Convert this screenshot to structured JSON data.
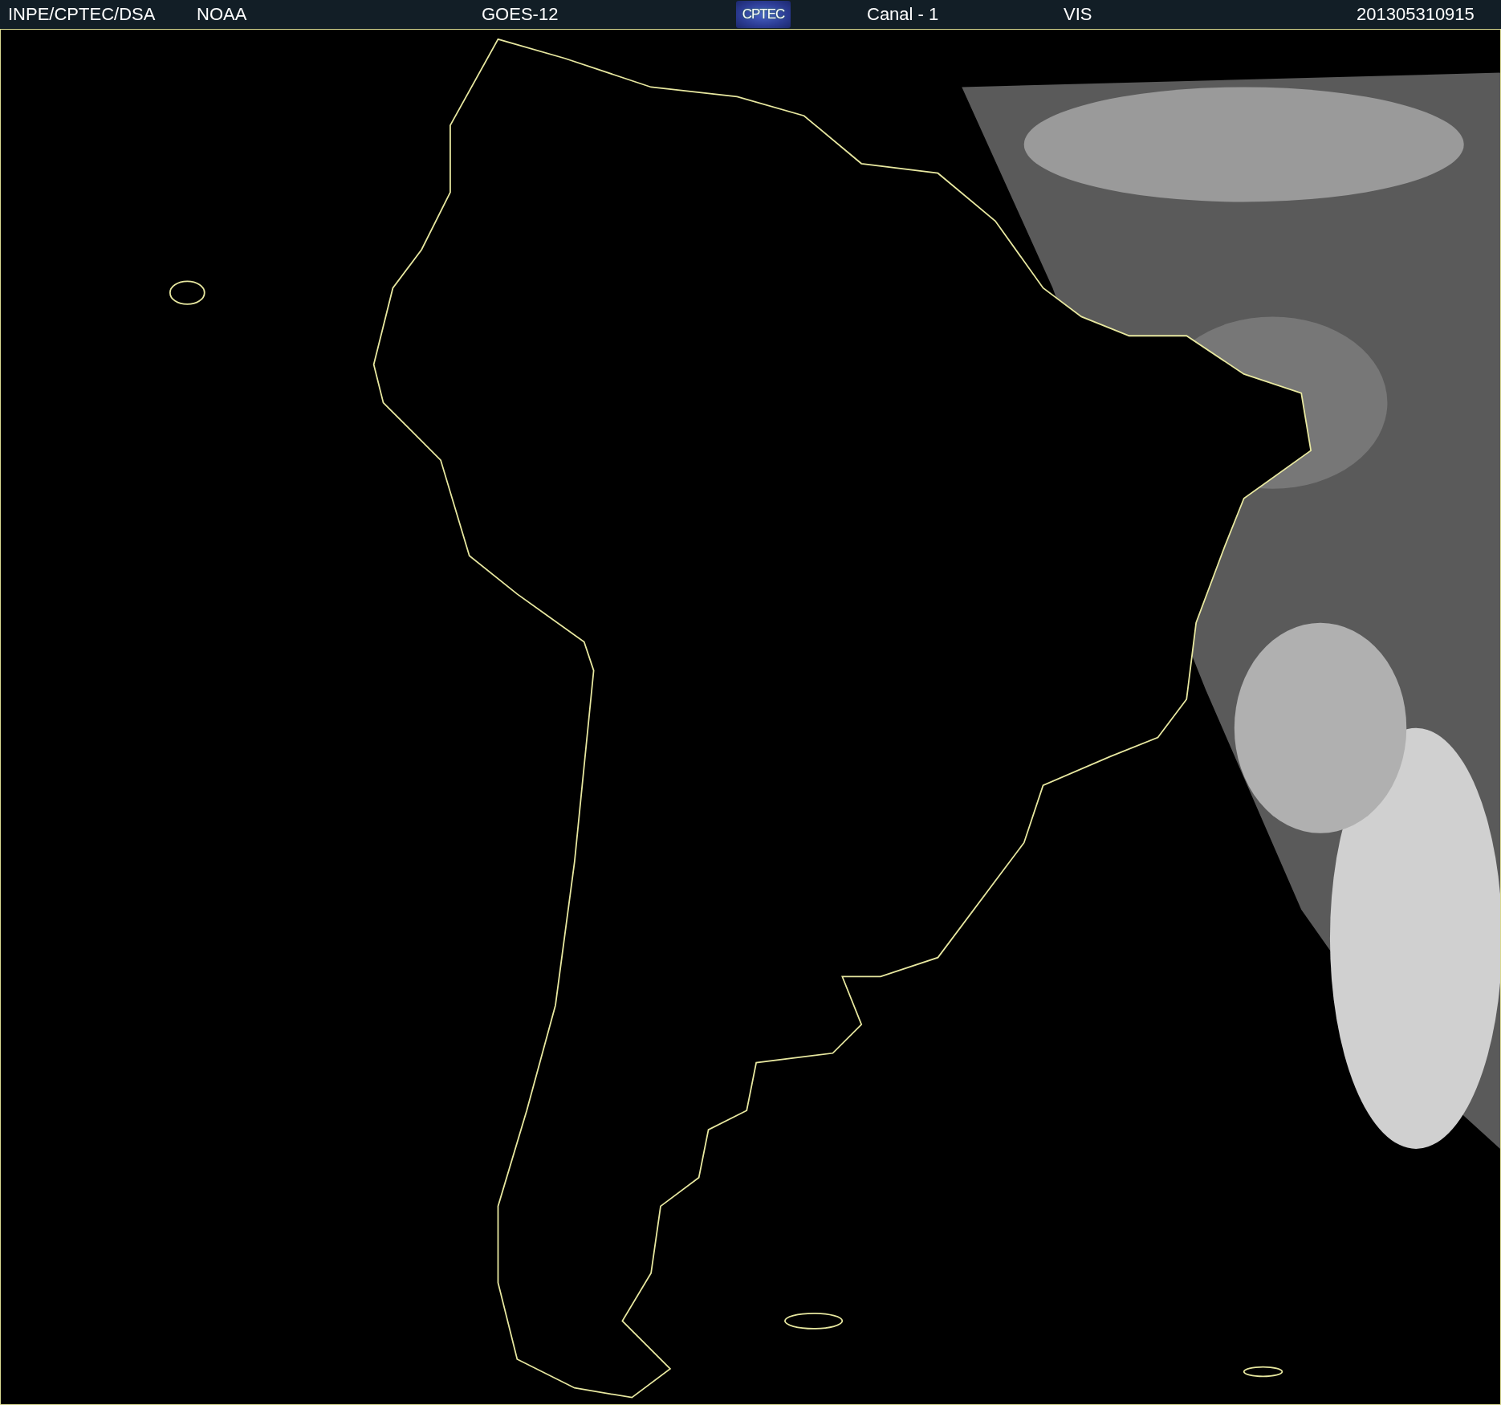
{
  "header": {
    "source": "INPE/CPTEC/DSA",
    "agency": "NOAA",
    "satellite": "GOES-12",
    "logo": "CPTEC",
    "channel": "Canal - 1",
    "band": "VIS",
    "timestamp": "201305310915"
  }
}
